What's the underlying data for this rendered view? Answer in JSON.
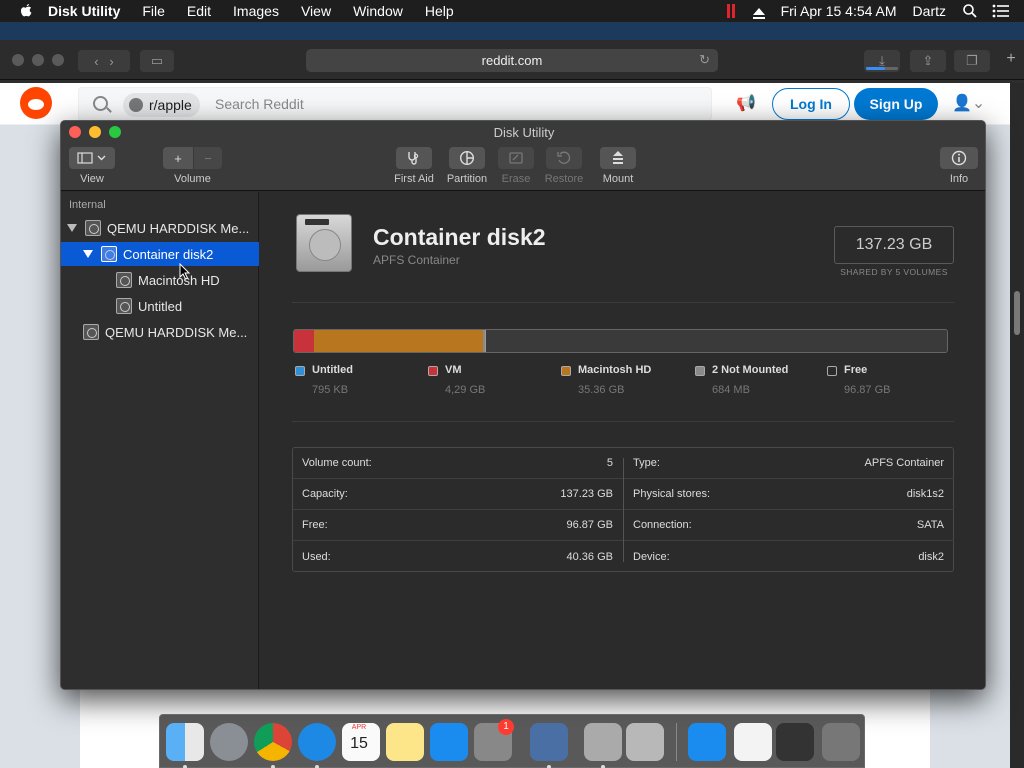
{
  "menubar": {
    "app_name": "Disk Utility",
    "menus": [
      "File",
      "Edit",
      "Images",
      "View",
      "Window",
      "Help"
    ],
    "datetime": "Fri Apr 15  4:54 AM",
    "user": "Dartz"
  },
  "safari": {
    "address": "reddit.com"
  },
  "reddit": {
    "subreddit_chip": "r/apple",
    "search_placeholder": "Search Reddit",
    "login_label": "Log In",
    "signup_label": "Sign Up"
  },
  "window": {
    "title": "Disk Utility",
    "toolbar": {
      "view_label": "View",
      "volume_label": "Volume",
      "add_symbol": "+",
      "remove_symbol": "−",
      "first_aid_label": "First Aid",
      "partition_label": "Partition",
      "erase_label": "Erase",
      "restore_label": "Restore",
      "mount_label": "Mount",
      "info_label": "Info"
    }
  },
  "sidebar": {
    "header": "Internal",
    "items": [
      {
        "label": "QEMU HARDDISK Me..."
      },
      {
        "label": "Container disk2"
      },
      {
        "label": "Macintosh HD"
      },
      {
        "label": "Untitled"
      },
      {
        "label": "QEMU HARDDISK Me..."
      }
    ]
  },
  "detail": {
    "title": "Container disk2",
    "subtitle": "APFS Container",
    "size": "137.23 GB",
    "size_note": "SHARED BY 5 VOLUMES",
    "usage": [
      {
        "name": "Untitled",
        "size": "795 KB",
        "color": "#2f8fd8",
        "fraction": 0.0
      },
      {
        "name": "VM",
        "size": "4,29 GB",
        "color": "#c8323a",
        "fraction": 0.031
      },
      {
        "name": "Macintosh HD",
        "size": "35.36 GB",
        "color": "#b8761e",
        "fraction": 0.258
      },
      {
        "name": "2 Not Mounted",
        "size": "684 MB",
        "color": "#8a8a8a",
        "fraction": 0.005
      },
      {
        "name": "Free",
        "size": "96.87 GB",
        "color": "#3a3a3a",
        "fraction": 0.706
      }
    ],
    "info_left": [
      {
        "key": "Volume count:",
        "value": "5"
      },
      {
        "key": "Capacity:",
        "value": "137.23 GB"
      },
      {
        "key": "Free:",
        "value": "96.87 GB"
      },
      {
        "key": "Used:",
        "value": "40.36 GB"
      }
    ],
    "info_right": [
      {
        "key": "Type:",
        "value": "APFS Container"
      },
      {
        "key": "Physical stores:",
        "value": "disk1s2"
      },
      {
        "key": "Connection:",
        "value": "SATA"
      },
      {
        "key": "Device:",
        "value": "disk2"
      }
    ]
  },
  "dock": {
    "calendar_month": "APR",
    "calendar_day": "15",
    "badge_count": "1"
  }
}
